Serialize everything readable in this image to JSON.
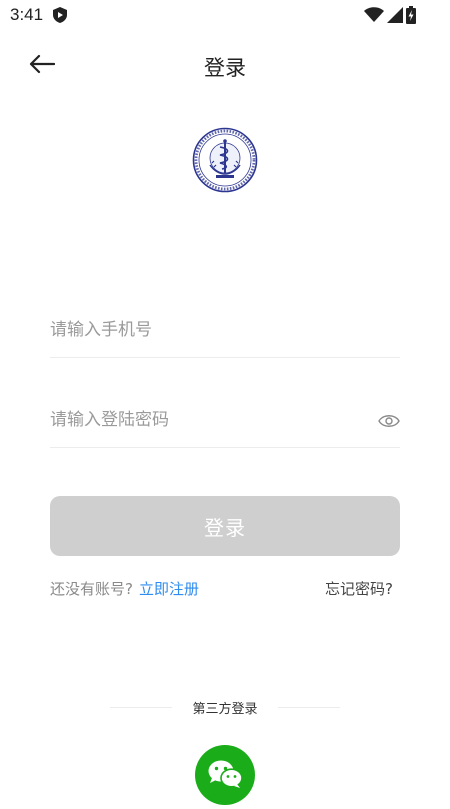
{
  "status_bar": {
    "time": "3:41",
    "icons": [
      "shield-icon",
      "wifi-icon",
      "signal-icon",
      "battery-charging-icon"
    ]
  },
  "header": {
    "title": "登录",
    "back_icon": "arrow-left-icon"
  },
  "logo": {
    "icon": "health-commission-emblem"
  },
  "form": {
    "phone_placeholder": "请输入手机号",
    "password_placeholder": "请输入登陆密码",
    "password_toggle_icon": "eye-icon",
    "login_label": "登录"
  },
  "links": {
    "no_account": "还没有账号?",
    "register": "立即注册",
    "forgot_password": "忘记密码?"
  },
  "third_party": {
    "label": "第三方登录",
    "wechat_icon": "wechat-icon"
  },
  "colors": {
    "login_button_disabled": "#cfcfcf",
    "link_blue": "#2f8cf0",
    "wechat_green": "#1aad19",
    "emblem_blue": "#2c3590"
  }
}
